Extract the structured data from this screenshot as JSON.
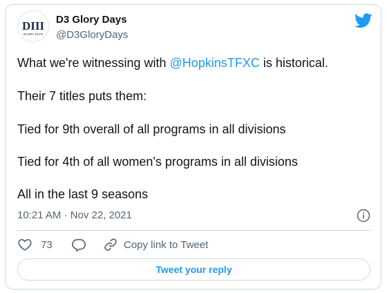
{
  "author": {
    "name": "D3 Glory Days",
    "handle": "@D3GloryDays",
    "avatar_icon": "d3-glory-days-logo",
    "avatar_logo_text": "DIII",
    "avatar_logo_subtext": "GLORY DAYS"
  },
  "tweet": {
    "line1_prefix": "What we're witnessing with ",
    "line1_mention": "@HopkinsTFXC",
    "line1_suffix": " is historical.",
    "line2": "Their 7 titles puts them:",
    "line3": "Tied for 9th overall of all programs in all divisions",
    "line4": "Tied for 4th of all women's programs in all divisions",
    "line5": "All in the last 9 seasons"
  },
  "timestamp": "10:21 AM · Nov 22, 2021",
  "actions": {
    "like_count": "73",
    "copy_link_label": "Copy link to Tweet",
    "reply_button_label": "Tweet your reply"
  },
  "icons": {
    "brand": "twitter-bird-icon",
    "info": "info-icon",
    "like": "heart-icon",
    "reply": "reply-bubble-icon",
    "copy_link": "link-icon"
  },
  "colors": {
    "accent": "#1d9bf0",
    "text": "#0f1419",
    "secondary": "#536471",
    "border": "#cfd9de",
    "logo_navy": "#1f2a4a"
  }
}
